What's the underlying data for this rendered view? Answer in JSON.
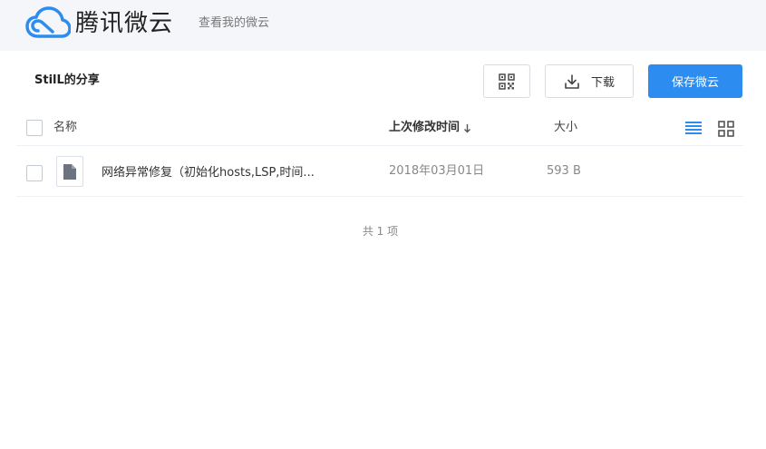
{
  "header": {
    "brand_name": "腾讯微云",
    "my_weiyun_link": "查看我的微云",
    "accent_color": "#2d8cf0",
    "logo_icon": "cloud-icon"
  },
  "share": {
    "title": "StilL的分享"
  },
  "toolbar": {
    "qr_icon": "qr-code-icon",
    "download_label": "下载",
    "save_label": "保存微云"
  },
  "table": {
    "columns": {
      "name": "名称",
      "modified": "上次修改时间",
      "size": "大小"
    },
    "sort_indicator": "arrow-down-icon",
    "view_modes": [
      "list-view-icon",
      "grid-view-icon"
    ],
    "rows": [
      {
        "name": "网络异常修复（初始化hosts,LSP,时间...",
        "modified": "2018年03月01日",
        "size": "593 B",
        "icon": "file-icon"
      }
    ]
  },
  "summary": {
    "total_text": "共 1 项"
  }
}
